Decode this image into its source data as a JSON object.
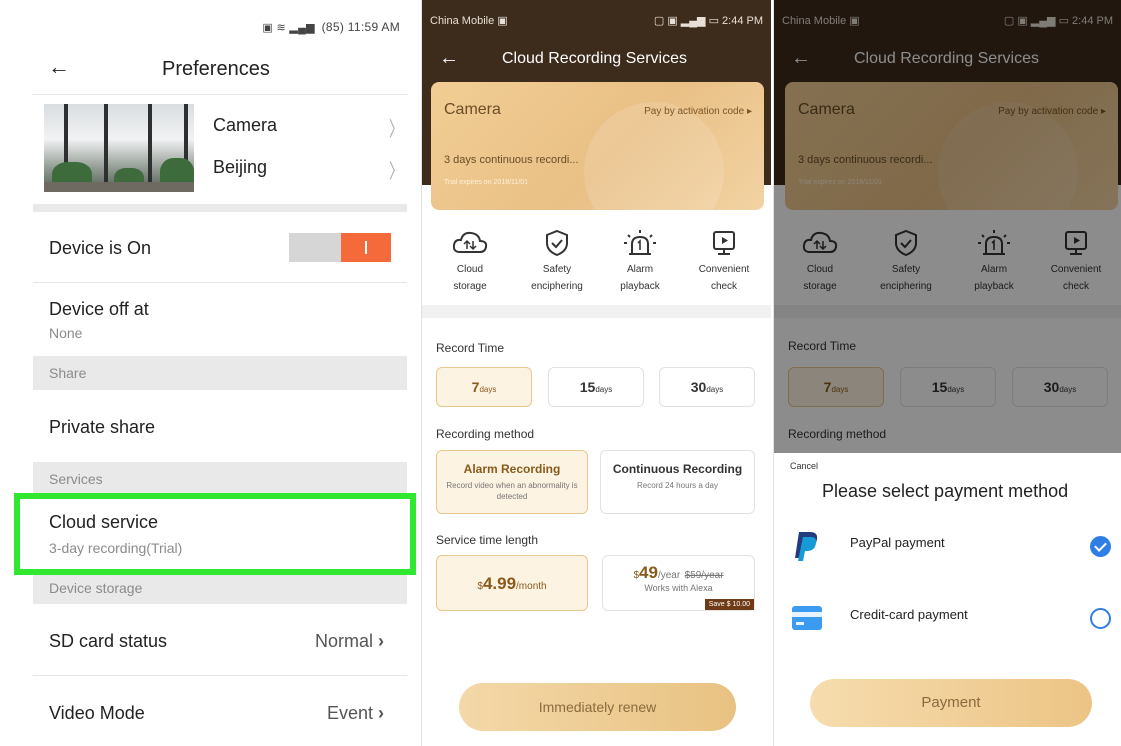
{
  "preferences": {
    "status_time": "11:59 AM",
    "status_battery": "85",
    "title": "Preferences",
    "camera_name": "Camera",
    "camera_location": "Beijing",
    "device_on_label": "Device is On",
    "device_on_state": true,
    "device_off_label": "Device off at",
    "device_off_value": "None",
    "share_section": "Share",
    "private_share_label": "Private share",
    "services_section": "Services",
    "cloud_service_label": "Cloud service",
    "cloud_service_value": "3-day recording(Trial)",
    "device_storage_section": "Device storage",
    "sd_card_label": "SD card status",
    "sd_card_value": "Normal",
    "video_mode_label": "Video Mode",
    "video_mode_value": "Event",
    "highlight_color": "#2fe82f",
    "toggle_color": "#f56a3a"
  },
  "cloud": {
    "carrier": "China Mobile",
    "status_time": "2:44 PM",
    "title": "Cloud Recording Services",
    "card_title": "Camera",
    "pay_by_code": "Pay by activation code",
    "card_desc": "3 days continuous recordi...",
    "card_trial": "Trial expires on 2018/11/01",
    "features": [
      {
        "icon": "cloud-storage-icon",
        "line1": "Cloud",
        "line2": "storage"
      },
      {
        "icon": "shield-check-icon",
        "line1": "Safety",
        "line2": "enciphering"
      },
      {
        "icon": "alarm-light-icon",
        "line1": "Alarm",
        "line2": "playback"
      },
      {
        "icon": "play-screen-icon",
        "line1": "Convenient",
        "line2": "check"
      }
    ],
    "record_time_label": "Record Time",
    "record_days": [
      {
        "num": "7",
        "unit": "days",
        "selected": true
      },
      {
        "num": "15",
        "unit": "days",
        "selected": false
      },
      {
        "num": "30",
        "unit": "days",
        "selected": false
      }
    ],
    "recording_method_label": "Recording method",
    "methods": [
      {
        "title": "Alarm Recording",
        "desc": "Record video when an abnormality is detected",
        "selected": true
      },
      {
        "title": "Continuous Recording",
        "desc": "Record 24 hours a day",
        "selected": false
      }
    ],
    "service_length_label": "Service time length",
    "price_monthly": "$4.99/month",
    "price_monthly_currency": "$",
    "price_monthly_amount": "4.99",
    "price_monthly_unit": "/month",
    "price_yearly_currency": "$",
    "price_yearly_amount": "49",
    "price_yearly_unit": "/year",
    "price_yearly_was": "$59/year",
    "price_yearly_note": "Works with Alexa",
    "price_yearly_save": "Save $ 10.00",
    "renew_button": "Immediately renew",
    "accent_color": "#8a5a1a",
    "header_color": "#3d2b1c"
  },
  "payment": {
    "cancel": "Cancel",
    "title": "Please select payment method",
    "options": [
      {
        "label": "PayPal payment",
        "icon": "paypal-icon",
        "selected": true
      },
      {
        "label": "Credit-card payment",
        "icon": "credit-card-icon",
        "selected": false
      }
    ],
    "pay_button": "Payment",
    "check_color": "#2f7ee6"
  }
}
